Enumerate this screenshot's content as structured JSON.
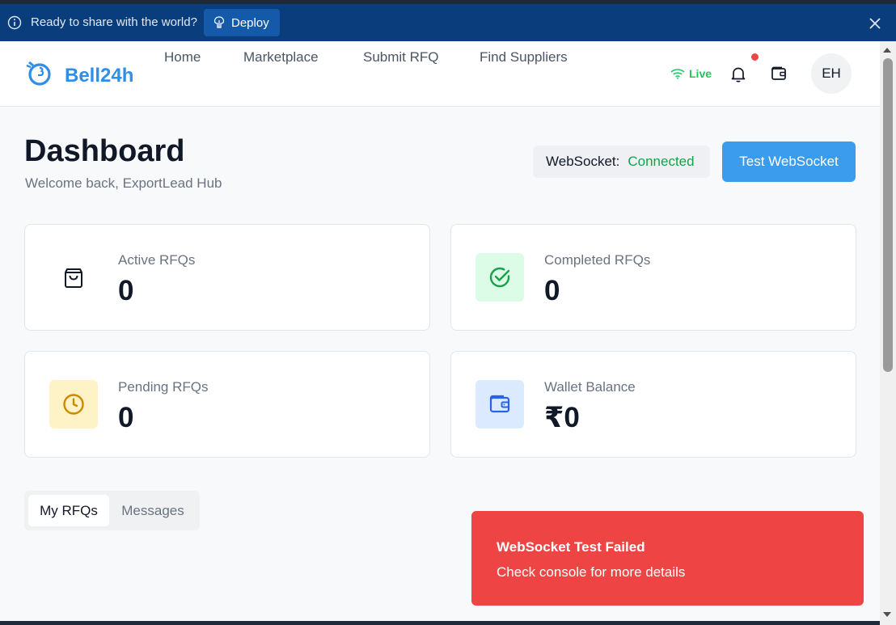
{
  "banner": {
    "text": "Ready to share with the world?",
    "deploy_label": "Deploy"
  },
  "nav": {
    "brand": "Bell24h",
    "links": [
      "Home",
      "Marketplace",
      "Submit RFQ",
      "Find Suppliers"
    ],
    "live_label": "Live",
    "avatar_initials": "EH"
  },
  "dashboard": {
    "title": "Dashboard",
    "welcome": "Welcome back, ExportLead Hub",
    "websocket_label": "WebSocket:",
    "websocket_status": "Connected",
    "test_button": "Test WebSocket"
  },
  "stats": [
    {
      "label": "Active RFQs",
      "value": "0",
      "icon": "shopping-bag-icon"
    },
    {
      "label": "Completed RFQs",
      "value": "0",
      "icon": "check-circle-icon"
    },
    {
      "label": "Pending RFQs",
      "value": "0",
      "icon": "clock-icon"
    },
    {
      "label": "Wallet Balance",
      "value": "₹0",
      "icon": "wallet-icon"
    }
  ],
  "tabs": [
    "My RFQs",
    "Messages"
  ],
  "toast": {
    "title": "WebSocket Test Failed",
    "description": "Check console for more details"
  },
  "colors": {
    "brand": "#2e8ee8",
    "banner": "#0a3d7c",
    "primary_button": "#3b9cee",
    "connected": "#16a34a",
    "toast": "#ef4444"
  }
}
